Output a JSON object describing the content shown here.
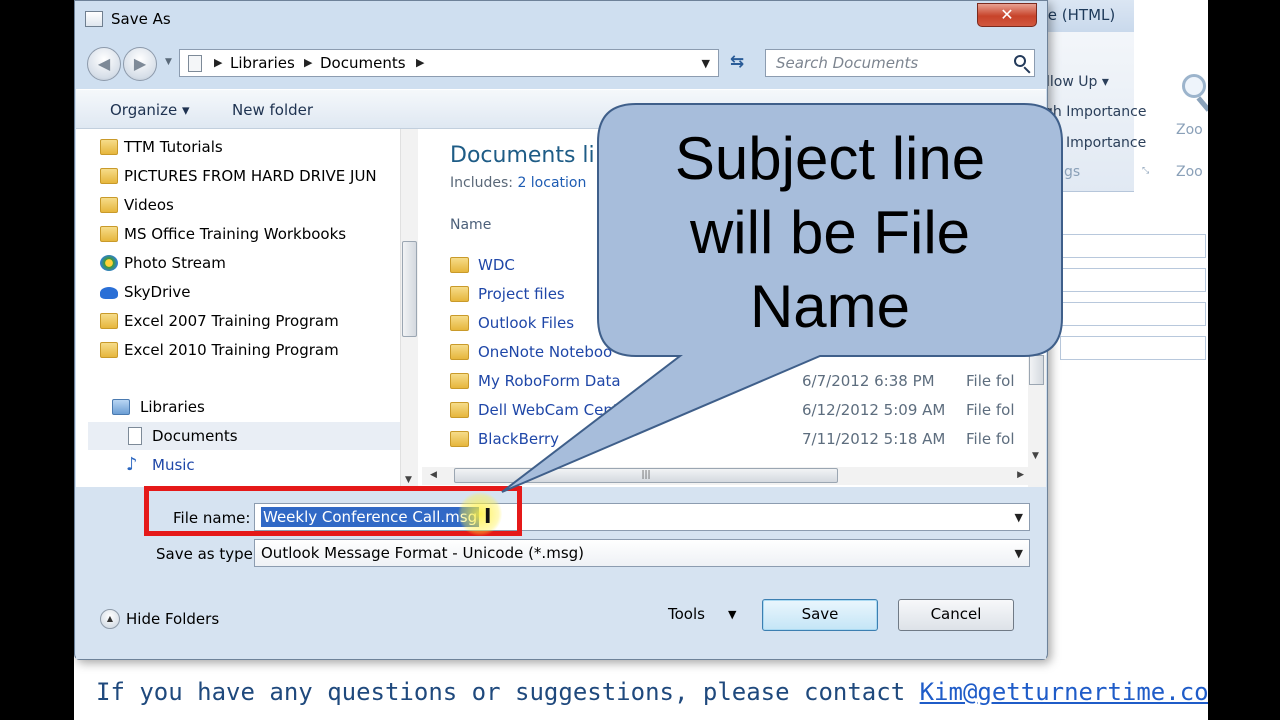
{
  "background_window": {
    "title": "ll - Message (HTML)",
    "ribbon": {
      "follow_up": "llow Up",
      "high_importance": "gh Importance",
      "low_importance": "Importance",
      "tags_group": "gs",
      "zoom_label": "Zoo",
      "zoom_group": "Zoo"
    },
    "footer_text": "If you have any questions or suggestions, please contact ",
    "footer_link": "Kim@getturnertime.com",
    "footer_end": "."
  },
  "dialog": {
    "title": "Save As",
    "close_label": "✕",
    "breadcrumbs": [
      "Libraries",
      "Documents"
    ],
    "search_placeholder": "Search Documents",
    "toolbar": {
      "organize_label": "Organize",
      "new_folder_label": "New folder"
    },
    "nav_pane": {
      "items": [
        {
          "label": "TTM Tutorials",
          "icon": "folder-icon"
        },
        {
          "label": "PICTURES FROM HARD DRIVE JUN",
          "icon": "folder-icon"
        },
        {
          "label": "Videos",
          "icon": "folder-icon"
        },
        {
          "label": "MS Office Training Workbooks",
          "icon": "folder-icon"
        },
        {
          "label": "Photo Stream",
          "icon": "photo-stream-icon"
        },
        {
          "label": "SkyDrive",
          "icon": "skydrive-icon"
        },
        {
          "label": "Excel 2007 Training Program",
          "icon": "folder-icon"
        },
        {
          "label": "Excel 2010 Training Program",
          "icon": "folder-icon"
        }
      ],
      "libraries_label": "Libraries",
      "libraries_children": [
        {
          "label": "Documents",
          "icon": "document-icon",
          "selected": true
        },
        {
          "label": "Music",
          "icon": "music-icon"
        }
      ]
    },
    "file_pane": {
      "library_title": "Documents li",
      "includes_label": "Includes:",
      "includes_link": "2 location",
      "column_name": "Name",
      "rows": [
        {
          "name": "WDC",
          "date": "",
          "type": ""
        },
        {
          "name": "Project files",
          "date": "",
          "type": ""
        },
        {
          "name": "Outlook Files",
          "date": "",
          "type": ""
        },
        {
          "name": "OneNote Noteboo",
          "date": "",
          "type": ""
        },
        {
          "name": "My RoboForm Data",
          "date": "6/7/2012 6:38 PM",
          "type": "File fol"
        },
        {
          "name": "Dell WebCam Cent",
          "date": "6/12/2012 5:09 AM",
          "type": "File fol"
        },
        {
          "name": "BlackBerry",
          "date": "7/11/2012 5:18 AM",
          "type": "File fol"
        }
      ]
    },
    "form": {
      "file_name_label": "File name:",
      "file_name_value": "Weekly Conference Call.msg",
      "save_type_label": "Save as type:",
      "save_type_value": "Outlook Message Format - Unicode (*.msg)",
      "hide_folders_label": "Hide Folders",
      "tools_label": "Tools",
      "save_label": "Save",
      "cancel_label": "Cancel"
    }
  },
  "callout": {
    "text_line1": "Subject line",
    "text_line2": "will be File",
    "text_line3": "Name",
    "fill_color": "#a7bddb",
    "stroke_color": "#3f5f8a"
  },
  "annotation": {
    "box_color": "#e51919",
    "highlight_color": "#fff03c"
  }
}
